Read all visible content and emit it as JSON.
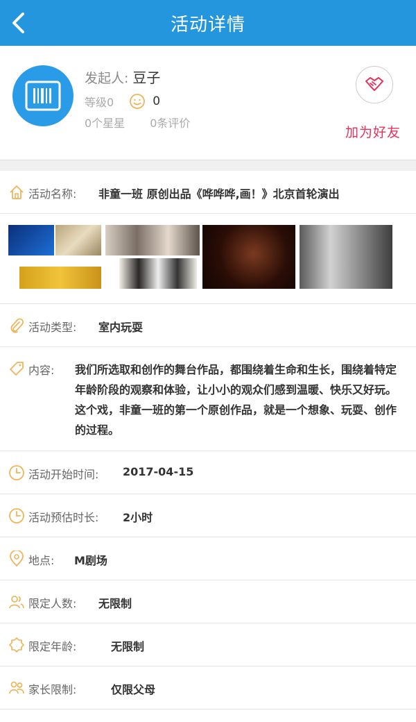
{
  "header": {
    "title": "活动详情"
  },
  "profile": {
    "organizer_label": "发起人:",
    "organizer_name": "豆子",
    "level_label": "等级0",
    "smile_count": "0",
    "stars_label": "0个星星",
    "reviews_label": "0条评价",
    "add_friend_label": "加为好友"
  },
  "details": {
    "activity_name": {
      "label": "活动名称:",
      "value": "非童一班 原创出品《哗哗哗,画！》北京首轮演出"
    },
    "activity_type": {
      "label": "活动类型:",
      "value": "室内玩耍"
    },
    "content": {
      "label": "内容:",
      "value": "我们所选取和创作的舞台作品，都围绕着生命和生长，围绕着特定年龄阶段的观察和体验，让小小的观众们感到温暖、快乐又好玩。这个戏，非童一班的第一个原创作品，就是一个想象、玩耍、创作的过程。"
    },
    "start_time": {
      "label": "活动开始时间:",
      "value": "2017-04-15"
    },
    "duration": {
      "label": "活动预估时长:",
      "value": "2小时"
    },
    "location": {
      "label": "地点:",
      "value": "M剧场"
    },
    "people_limit": {
      "label": "限定人数:",
      "value": "无限制"
    },
    "age_limit": {
      "label": "限定年龄:",
      "value": "无限制"
    },
    "parent_limit": {
      "label": "家长限制:",
      "value": "仅限父母"
    }
  },
  "colors": {
    "header": "#2496de",
    "accent_icon": "#f0b45a",
    "add_friend": "#e6325a"
  }
}
